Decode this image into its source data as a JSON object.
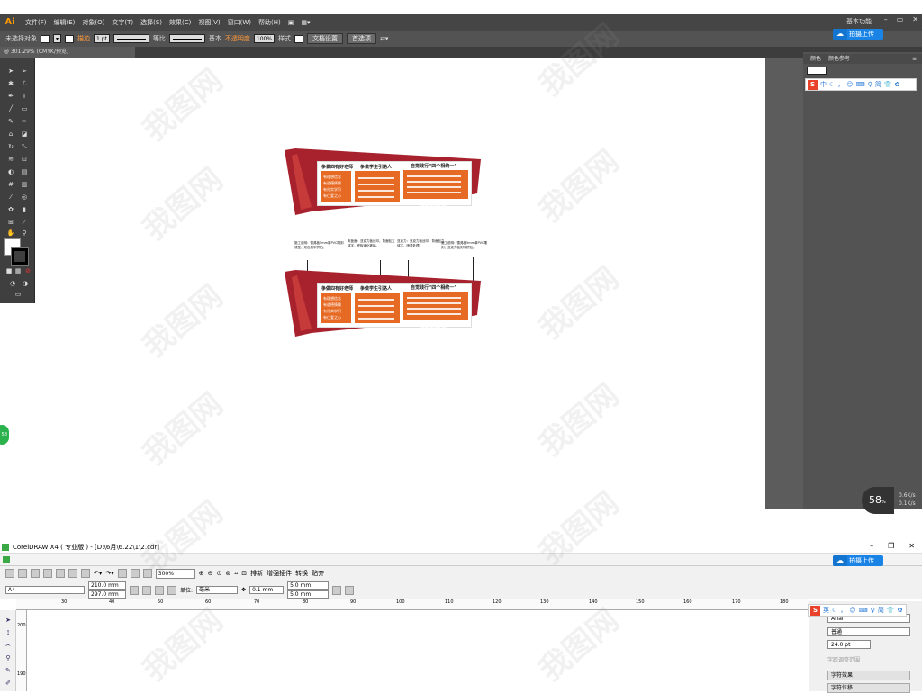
{
  "illustrator": {
    "logo": "Ai",
    "menu": [
      "文件(F)",
      "编辑(E)",
      "对象(O)",
      "文字(T)",
      "选择(S)",
      "效果(C)",
      "视图(V)",
      "窗口(W)",
      "帮助(H)"
    ],
    "workspace": "基本功能",
    "control_bar": {
      "no_selection": "未选择对象",
      "stroke_label": "描边",
      "stroke_value": "1 pt",
      "profile": "等比",
      "brush": "基本",
      "opacity_label": "不透明度",
      "opacity_value": "100%",
      "style_label": "样式",
      "doc_setup": "文档设置",
      "preferences": "首选项"
    },
    "doc_tab": "@ 301.29% (CMYK/预览)",
    "panel_tabs": [
      "颜色",
      "颜色参考"
    ],
    "status_speed": "58",
    "speed_unit": "%",
    "net_up": "0.6K/s",
    "net_down": "0.1K/s",
    "green_badge": "58"
  },
  "ime": {
    "logo": "S",
    "items": [
      "中",
      "英",
      "简",
      "☁"
    ],
    "upload_label": "拍摄上传"
  },
  "artwork": {
    "col1_title": "争做四有好老师",
    "col2_title": "争做学生引路人",
    "col3_title": "自觉践行“四个相统一”",
    "col1_lines": [
      "有理想信念",
      "有道德情操",
      "有扎实学识",
      "有仁爱之心"
    ],
    "footer": "好教师标准",
    "annotations": [
      "施工说明：雪弗板5mm厚PVC雕刻成型，双色刻字拼贴。",
      "夹板面：亚克力板丝印，背面贴立体字，底板钢化玻璃。",
      "亚克力：亚克力板丝印，背面贴立体字，喷漆处理。",
      "施工说明：雪弗板5mm厚PVC雕刻，亚克力板刻字拼贴。"
    ]
  },
  "corel": {
    "title": "CorelDRAW X4 ( 专业版 ) - [D:\\6月\\6.22\\1\\2.cdr]",
    "zoom": "300%",
    "toolbar_items": [
      "排新",
      "增强插件",
      "转换",
      "贴齐"
    ],
    "page_size": "A4",
    "width": "210.0 mm",
    "height": "297.0 mm",
    "unit_label": "单位:",
    "unit_value": "毫米",
    "nudge": "0.1 mm",
    "dup_x": "5.0 mm",
    "dup_y": "5.0 mm",
    "ruler_ticks": [
      "30",
      "40",
      "50",
      "60",
      "70",
      "80",
      "90",
      "100",
      "110",
      "120",
      "130",
      "140",
      "150",
      "160",
      "170",
      "180"
    ],
    "vruler_ticks": [
      "200",
      "190"
    ],
    "docker": {
      "font": "Arial",
      "style": "普通",
      "size": "24.0 pt",
      "range_label": "字距调整范围",
      "effects_label": "字符效果",
      "position_label": "字符位移"
    }
  },
  "watermark": "我图网"
}
